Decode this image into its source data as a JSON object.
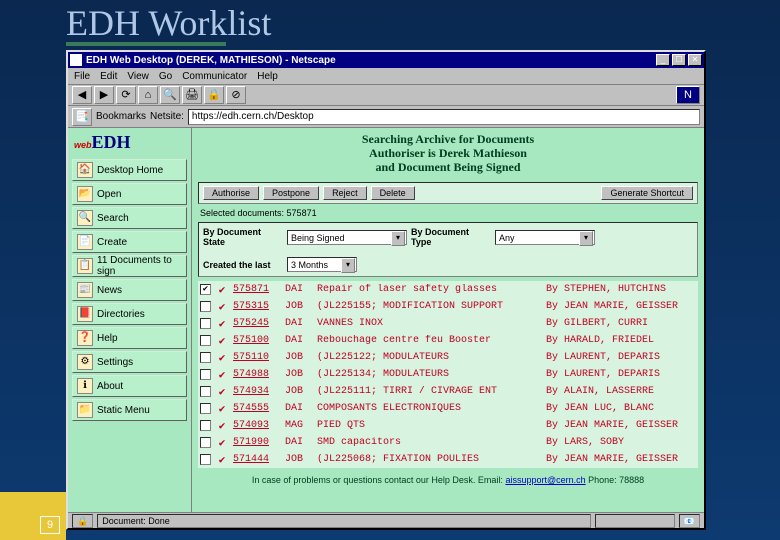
{
  "slide_title": "EDH Worklist",
  "slide_number": "9",
  "window": {
    "title": "EDH Web Desktop (DEREK, MATHIESON) - Netscape",
    "menus": [
      "File",
      "Edit",
      "View",
      "Go",
      "Communicator",
      "Help"
    ],
    "bookmarks_label": "Bookmarks",
    "netsite_label": "Netsite:",
    "url": "https://edh.cern.ch/Desktop",
    "status": "Document: Done"
  },
  "logo": {
    "web": "web",
    "edh": "EDH"
  },
  "nav": [
    {
      "icon": "🏠",
      "label": "Desktop Home"
    },
    {
      "icon": "📂",
      "label": "Open"
    },
    {
      "icon": "🔍",
      "label": "Search"
    },
    {
      "icon": "📄",
      "label": "Create"
    },
    {
      "icon": "📋",
      "label": "11 Documents to sign"
    },
    {
      "icon": "📰",
      "label": "News"
    },
    {
      "icon": "📕",
      "label": "Directories"
    },
    {
      "icon": "❓",
      "label": "Help"
    },
    {
      "icon": "⚙",
      "label": "Settings"
    },
    {
      "icon": "ℹ",
      "label": "About"
    },
    {
      "icon": "📁",
      "label": "Static Menu"
    }
  ],
  "search_header": {
    "line1": "Searching Archive for Documents",
    "line2": "Authoriser is Derek Mathieson",
    "line3": "and Document Being Signed"
  },
  "actions": {
    "authorise": "Authorise",
    "postpone": "Postpone",
    "reject": "Reject",
    "delete": "Delete",
    "shortcut": "Generate Shortcut"
  },
  "selected": "Selected documents: 575871",
  "filters": {
    "state_label": "By Document State",
    "state_value": "Being Signed",
    "type_label": "By Document Type",
    "type_value": "Any",
    "created_label": "Created the last",
    "created_value": "3 Months"
  },
  "rows": [
    {
      "ck": true,
      "id": "575871",
      "type": "DAI",
      "desc": "Repair of laser safety glasses",
      "by": "By STEPHEN, HUTCHINS"
    },
    {
      "ck": false,
      "id": "575315",
      "type": "JOB",
      "desc": "(JL225155; MODIFICATION SUPPORT",
      "by": "By JEAN MARIE, GEISSER"
    },
    {
      "ck": false,
      "id": "575245",
      "type": "DAI",
      "desc": "VANNES INOX",
      "by": "By GILBERT, CURRI"
    },
    {
      "ck": false,
      "id": "575100",
      "type": "DAI",
      "desc": "Rebouchage centre feu Booster",
      "by": "By HARALD, FRIEDEL"
    },
    {
      "ck": false,
      "id": "575110",
      "type": "JOB",
      "desc": "(JL225122; MODULATEURS",
      "by": "By LAURENT, DEPARIS"
    },
    {
      "ck": false,
      "id": "574988",
      "type": "JOB",
      "desc": "(JL225134; MODULATEURS",
      "by": "By LAURENT, DEPARIS"
    },
    {
      "ck": false,
      "id": "574934",
      "type": "JOB",
      "desc": "(JL225111; TIRRI / CIVRAGE ENT",
      "by": "By ALAIN, LASSERRE"
    },
    {
      "ck": false,
      "id": "574555",
      "type": "DAI",
      "desc": "COMPOSANTS ELECTRONIQUES",
      "by": "By JEAN LUC, BLANC"
    },
    {
      "ck": false,
      "id": "574093",
      "type": "MAG",
      "desc": "PIED QTS",
      "by": "By JEAN MARIE, GEISSER"
    },
    {
      "ck": false,
      "id": "571990",
      "type": "DAI",
      "desc": "SMD capacitors",
      "by": "By LARS, SOBY"
    },
    {
      "ck": false,
      "id": "571444",
      "type": "JOB",
      "desc": "(JL225068; FIXATION POULIES",
      "by": "By JEAN MARIE, GEISSER"
    }
  ],
  "help_footer": {
    "prefix": "In case of problems or questions contact our Help Desk. Email: ",
    "email": "aissupport@cern.ch",
    "suffix": " Phone: 78888"
  }
}
